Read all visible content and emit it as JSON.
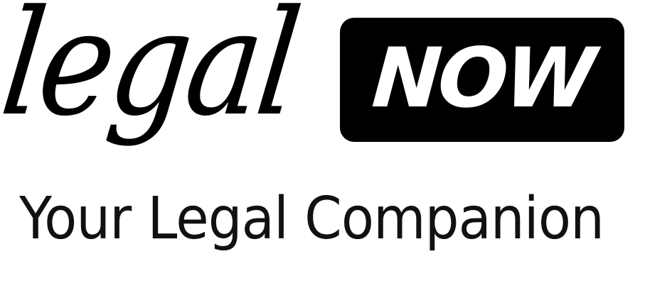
{
  "logo": {
    "script_word": "legal",
    "boxed_word": "NOW",
    "tagline": "Your Legal Companion"
  },
  "colors": {
    "primary": "#000000",
    "background": "#ffffff",
    "box_text": "#ffffff"
  }
}
